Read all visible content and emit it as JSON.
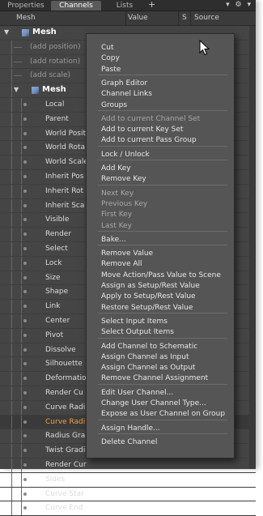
{
  "tabs": [
    {
      "label": "Properties",
      "active": false
    },
    {
      "label": "Channels",
      "active": true
    },
    {
      "label": "Lists",
      "active": false
    }
  ],
  "tab_add": "+",
  "columns": {
    "name": "Mesh",
    "value": "Value",
    "s": "S",
    "source": "Source"
  },
  "tree": {
    "root_label": "Mesh",
    "add_items": [
      "(add position)",
      "(add rotation)",
      "(add scale)"
    ],
    "sub_label": "Mesh",
    "channels": [
      "Local",
      "Parent",
      "World Posit",
      "World Rota",
      "World Scale",
      "Inherit Pos",
      "Inherit Rot",
      "Inherit Sca",
      "Visible",
      "Render",
      "Select",
      "Lock",
      "Size",
      "Shape",
      "Link",
      "Center",
      "Pivot",
      "Dissolve",
      "Silhouette",
      "Deformatio",
      "Render Cu",
      "Curve Radi",
      "Curve Radi",
      "Radius Gra",
      "Twist Gradi",
      "Render Cur",
      "Sides",
      "Curve Star",
      "Curve End"
    ],
    "selected_index": 22
  },
  "menu": {
    "groups": [
      [
        {
          "label": "Cut",
          "enabled": true
        },
        {
          "label": "Copy",
          "enabled": true
        },
        {
          "label": "Paste",
          "enabled": true
        }
      ],
      [
        {
          "label": "Graph Editor",
          "enabled": true
        },
        {
          "label": "Channel Links",
          "enabled": true
        },
        {
          "label": "Groups",
          "enabled": true
        }
      ],
      [
        {
          "label": "Add to current Channel Set",
          "enabled": false
        },
        {
          "label": "Add to current Key Set",
          "enabled": true
        },
        {
          "label": "Add to current Pass Group",
          "enabled": true
        }
      ],
      [
        {
          "label": "Lock / Unlock",
          "enabled": true
        }
      ],
      [
        {
          "label": "Add Key",
          "enabled": true
        },
        {
          "label": "Remove Key",
          "enabled": true
        }
      ],
      [
        {
          "label": "Next Key",
          "enabled": false
        },
        {
          "label": "Previous Key",
          "enabled": false
        },
        {
          "label": "First Key",
          "enabled": false
        },
        {
          "label": "Last Key",
          "enabled": false
        }
      ],
      [
        {
          "label": "Bake...",
          "enabled": true
        }
      ],
      [
        {
          "label": "Remove Value",
          "enabled": true
        },
        {
          "label": "Remove All",
          "enabled": true
        },
        {
          "label": "Move Action/Pass Value to Scene",
          "enabled": true
        },
        {
          "label": "Assign as Setup/Rest Value",
          "enabled": true
        },
        {
          "label": "Apply to Setup/Rest Value",
          "enabled": true
        },
        {
          "label": "Restore Setup/Rest Value",
          "enabled": true
        }
      ],
      [
        {
          "label": "Select Input Items",
          "enabled": true
        },
        {
          "label": "Select Output Items",
          "enabled": true
        }
      ],
      [
        {
          "label": "Add Channel to Schematic",
          "enabled": true
        },
        {
          "label": "Assign Channel as Input",
          "enabled": true
        },
        {
          "label": "Assign Channel as Output",
          "enabled": true
        },
        {
          "label": "Remove Channel Assignment",
          "enabled": true
        }
      ],
      [
        {
          "label": "Edit User Channel...",
          "enabled": true
        },
        {
          "label": "Change User Channel Type...",
          "enabled": true
        },
        {
          "label": "Expose as User Channel on Group",
          "enabled": true
        }
      ],
      [
        {
          "label": "Assign Handle...",
          "enabled": true
        }
      ],
      [
        {
          "label": "Delete Channel",
          "enabled": true
        }
      ]
    ]
  },
  "colors": {
    "panel": "#454545",
    "menu": "#555555",
    "selected_text": "#f0a040"
  }
}
